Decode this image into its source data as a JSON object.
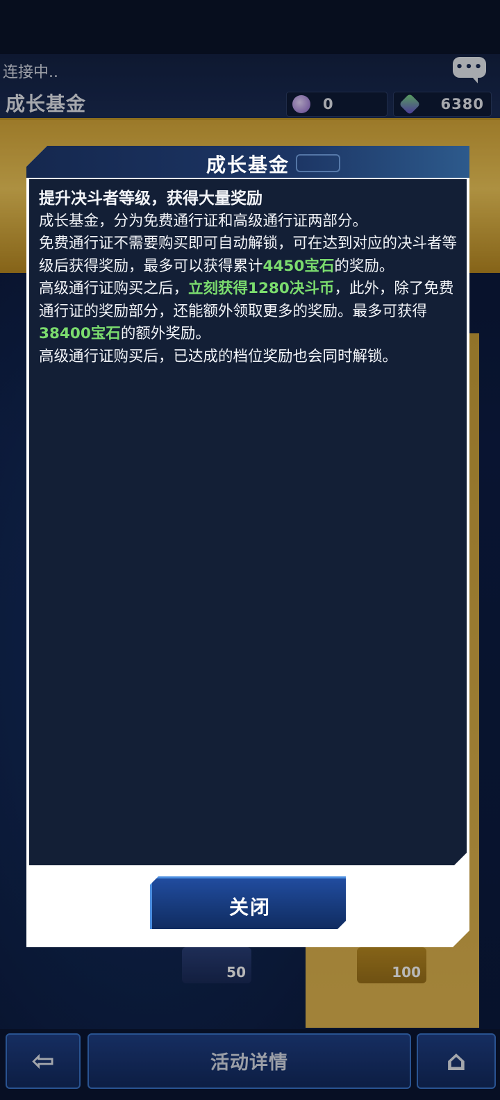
{
  "header": {
    "connection_status": "连接中..",
    "page_title": "成长基金",
    "currencies": [
      {
        "icon": "orb-coin-icon",
        "value": "0"
      },
      {
        "icon": "gem-icon",
        "value": "6380"
      }
    ]
  },
  "background_rewards": [
    {
      "icon": "gem-icon",
      "value": "50"
    },
    {
      "icon": "gem-icon",
      "value": "100"
    }
  ],
  "modal": {
    "title": "成长基金",
    "heading": "提升决斗者等级，获得大量奖励",
    "lines": {
      "l1": "成长基金，分为免费通行证和高级通行证两部分。",
      "l2a": "免费通行证不需要购买即可自动解锁，可在达到对应的决斗者等级后获得奖励，最多可以获得累计",
      "l2hl": "4450宝石",
      "l2b": "的奖励。",
      "l3a": "高级通行证购买之后，",
      "l3hl": "立刻获得1280决斗币",
      "l3b": "，此外，除了免费通行证的奖励部分，还能额外领取更多的奖励。最多可获得",
      "l3hl2": "38400宝石",
      "l3c": "的额外奖励。",
      "l4": "高级通行证购买后，已达成的档位奖励也会同时解锁。"
    },
    "close_label": "关闭"
  },
  "bottom_nav": {
    "back_icon": "back-arrow-icon",
    "detail_label": "活动详情",
    "home_icon": "home-icon"
  },
  "colors": {
    "highlight": "#7bdc6e",
    "modal_bg": "#131f36",
    "accent_blue": "#4b8ee0"
  }
}
